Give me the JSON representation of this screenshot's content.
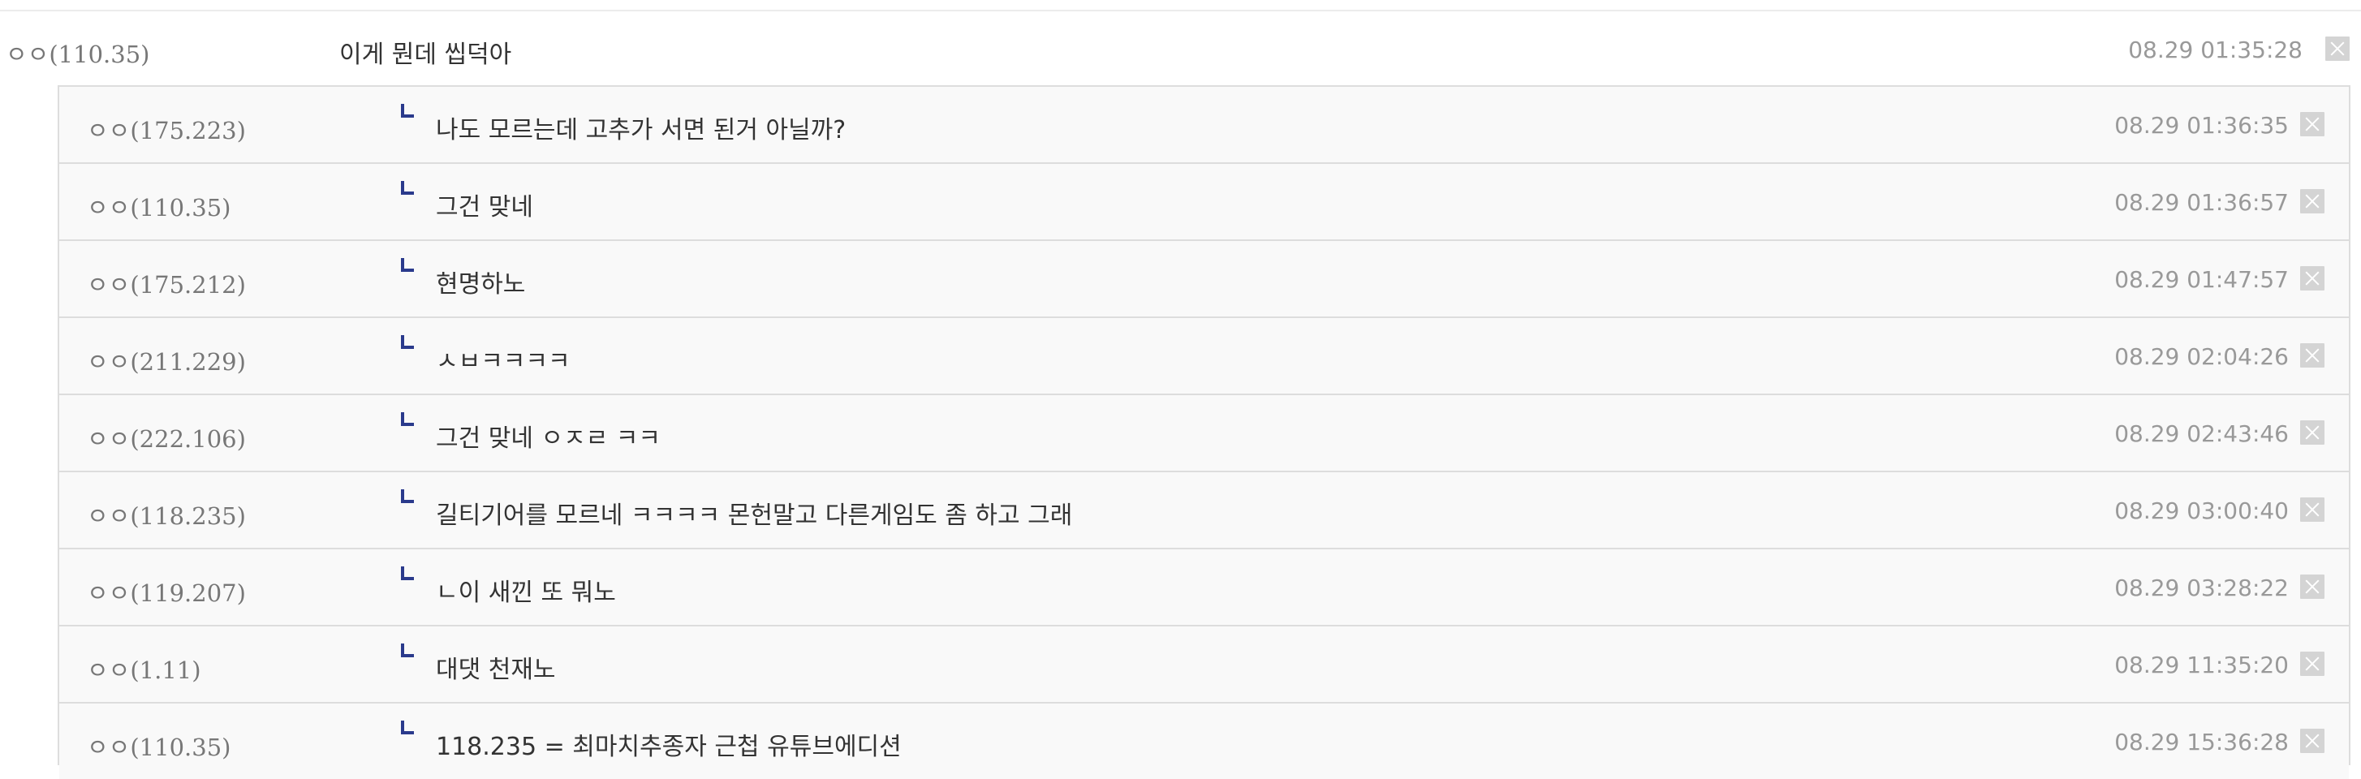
{
  "comment": {
    "nick": "ㅇㅇ(110.35)",
    "text": "이게 뭔데 씹덕아",
    "date": "08.29 01:35:28"
  },
  "replies": [
    {
      "nick": "ㅇㅇ(175.223)",
      "text": "나도 모르는데 고추가 서면 된거 아닐까?",
      "date": "08.29 01:36:35"
    },
    {
      "nick": "ㅇㅇ(110.35)",
      "text": "그건 맞네",
      "date": "08.29 01:36:57"
    },
    {
      "nick": "ㅇㅇ(175.212)",
      "text": "현명하노",
      "date": "08.29 01:47:57"
    },
    {
      "nick": "ㅇㅇ(211.229)",
      "text": "ㅅㅂㅋㅋㅋㅋ",
      "date": "08.29 02:04:26"
    },
    {
      "nick": "ㅇㅇ(222.106)",
      "text": "그건 맞네 ㅇㅈㄹ ㅋㅋ",
      "date": "08.29 02:43:46"
    },
    {
      "nick": "ㅇㅇ(118.235)",
      "text": "길티기어를 모르네 ㅋㅋㅋㅋ 몬헌말고 다른게임도 좀 하고 그래",
      "date": "08.29 03:00:40"
    },
    {
      "nick": "ㅇㅇ(119.207)",
      "text": "ㄴ이 새낀 또 뭐노",
      "date": "08.29 03:28:22"
    },
    {
      "nick": "ㅇㅇ(1.11)",
      "text": "대댓 천재노",
      "date": "08.29 11:35:20"
    },
    {
      "nick": "ㅇㅇ(110.35)",
      "text": "118.235 = 최마치추종자 근첩 유튜브에디션",
      "date": "08.29 15:36:28"
    }
  ]
}
